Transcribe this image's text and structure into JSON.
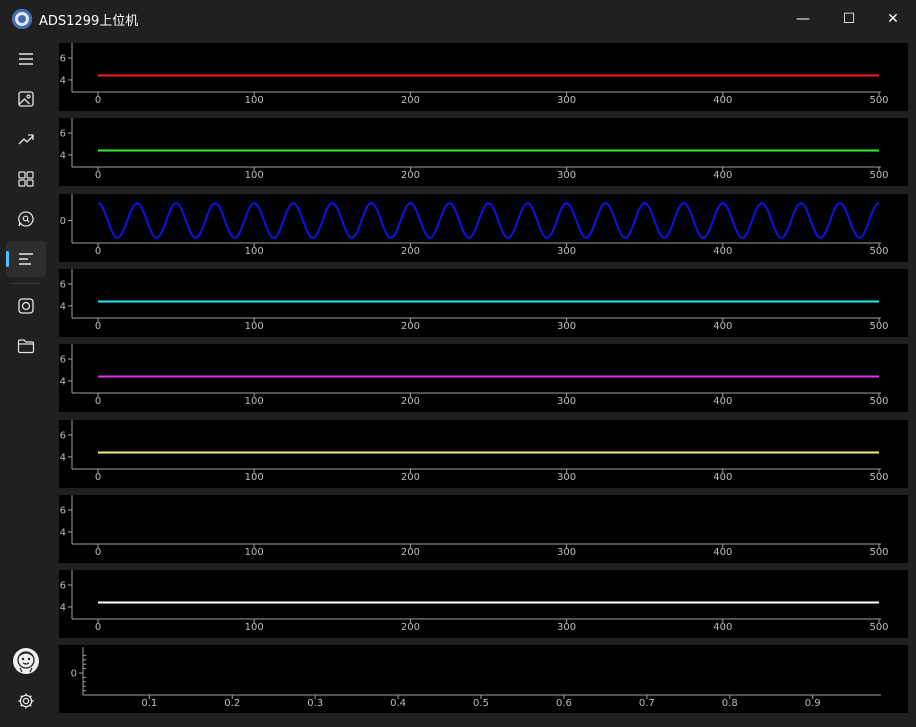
{
  "window": {
    "title": "ADS1299上位机",
    "minimize_glyph": "—",
    "maximize_glyph": "☐",
    "close_glyph": "✕"
  },
  "sidebar": {
    "items": [
      {
        "name": "menu",
        "icon": "hamburger-menu-icon"
      },
      {
        "name": "image",
        "icon": "image-icon"
      },
      {
        "name": "trend",
        "icon": "trend-line-icon"
      },
      {
        "name": "apps",
        "icon": "apps-grid-icon"
      },
      {
        "name": "chat-search",
        "icon": "chat-search-icon"
      },
      {
        "name": "waveform-view",
        "icon": "align-left-icon",
        "selected": true
      },
      {
        "name": "record",
        "icon": "record-icon"
      },
      {
        "name": "folder",
        "icon": "folder-icon"
      }
    ],
    "bottom": [
      {
        "name": "avatar",
        "icon": "avatar-icon"
      },
      {
        "name": "settings",
        "icon": "gear-icon"
      }
    ],
    "accent": "#4cc2ff"
  },
  "chart_data": [
    {
      "type": "line",
      "xlim": [
        0,
        500
      ],
      "ylim": [
        2.9,
        7.0
      ],
      "xticks": [
        0,
        100,
        200,
        300,
        400,
        500
      ],
      "yticks": [
        4,
        6
      ],
      "series": [
        {
          "color": "#ff1a1a",
          "x": [
            0,
            500
          ],
          "y": [
            4.4,
            4.4
          ]
        }
      ]
    },
    {
      "type": "line",
      "xlim": [
        0,
        500
      ],
      "ylim": [
        2.9,
        7.0
      ],
      "xticks": [
        0,
        100,
        200,
        300,
        400,
        500
      ],
      "yticks": [
        4,
        6
      ],
      "series": [
        {
          "color": "#33ee33",
          "x": [
            0,
            500
          ],
          "y": [
            4.4,
            4.4
          ]
        }
      ]
    },
    {
      "type": "line",
      "xlim": [
        0,
        500
      ],
      "ylim": [
        -1.3,
        1.3
      ],
      "xticks": [
        0,
        100,
        200,
        300,
        400,
        500
      ],
      "yticks": [
        0
      ],
      "series": [
        {
          "color": "#0a14e6",
          "function": "sine",
          "amplitude": 1,
          "period": 25,
          "x": [
            0,
            500
          ]
        }
      ]
    },
    {
      "type": "line",
      "xlim": [
        0,
        500
      ],
      "ylim": [
        2.9,
        7.0
      ],
      "xticks": [
        0,
        100,
        200,
        300,
        400,
        500
      ],
      "yticks": [
        4,
        6
      ],
      "series": [
        {
          "color": "#22e8f5",
          "x": [
            0,
            500
          ],
          "y": [
            4.4,
            4.4
          ]
        }
      ]
    },
    {
      "type": "line",
      "xlim": [
        0,
        500
      ],
      "ylim": [
        2.9,
        7.0
      ],
      "xticks": [
        0,
        100,
        200,
        300,
        400,
        500
      ],
      "yticks": [
        4,
        6
      ],
      "series": [
        {
          "color": "#e233e2",
          "x": [
            0,
            500
          ],
          "y": [
            4.4,
            4.4
          ]
        }
      ]
    },
    {
      "type": "line",
      "xlim": [
        0,
        500
      ],
      "ylim": [
        2.9,
        7.0
      ],
      "xticks": [
        0,
        100,
        200,
        300,
        400,
        500
      ],
      "yticks": [
        4,
        6
      ],
      "series": [
        {
          "color": "#f5f06a",
          "x": [
            0,
            500
          ],
          "y": [
            4.4,
            4.4
          ]
        }
      ]
    },
    {
      "type": "line",
      "xlim": [
        0,
        500
      ],
      "ylim": [
        2.9,
        7.0
      ],
      "xticks": [
        0,
        100,
        200,
        300,
        400,
        500
      ],
      "yticks": [
        4,
        6
      ],
      "series": []
    },
    {
      "type": "line",
      "xlim": [
        0,
        500
      ],
      "ylim": [
        2.9,
        7.0
      ],
      "xticks": [
        0,
        100,
        200,
        300,
        400,
        500
      ],
      "yticks": [
        4,
        6
      ],
      "series": [
        {
          "color": "#ffffff",
          "x": [
            0,
            500
          ],
          "y": [
            4.4,
            4.4
          ]
        }
      ]
    },
    {
      "type": "line",
      "xlim": [
        0.02,
        0.98
      ],
      "ylim": [
        -1.0,
        1.0
      ],
      "xticks": [
        0.1,
        0.2,
        0.3,
        0.4,
        0.5,
        0.6,
        0.7,
        0.8,
        0.9
      ],
      "yticks": [
        0
      ],
      "minor_yticks": [
        -0.8,
        -0.6,
        -0.4,
        -0.2,
        0.2,
        0.4,
        0.6,
        0.8
      ],
      "series": []
    }
  ]
}
